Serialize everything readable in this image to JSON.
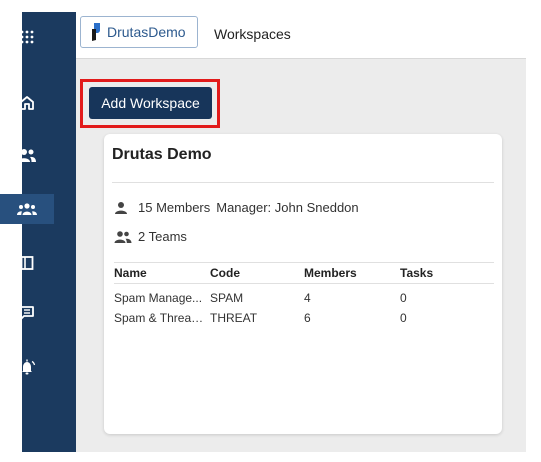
{
  "topbar": {
    "brand_name": "DrutasDemo",
    "title": "Workspaces"
  },
  "sidebar": {
    "items": [
      {
        "icon": "grid-icon"
      },
      {
        "icon": "home-icon"
      },
      {
        "icon": "users-icon"
      },
      {
        "icon": "teams-icon",
        "active": true
      },
      {
        "icon": "book-icon"
      },
      {
        "icon": "message-icon"
      },
      {
        "icon": "alarm-icon"
      }
    ]
  },
  "main": {
    "add_button_label": "Add Workspace"
  },
  "workspace_card": {
    "title": "Drutas Demo",
    "members_text": "15 Members",
    "manager_text": "Manager: John Sneddon",
    "teams_text": "2 Teams",
    "table": {
      "headers": [
        "Name",
        "Code",
        "Members",
        "Tasks"
      ],
      "rows": [
        [
          "Spam Manage...",
          "SPAM",
          "4",
          "0"
        ],
        [
          "Spam & Threat ...",
          "THREAT",
          "6",
          "0"
        ]
      ]
    }
  },
  "colors": {
    "sidebar": "#1b3a5f",
    "button": "#17355a",
    "highlight": "#e21b1b"
  }
}
